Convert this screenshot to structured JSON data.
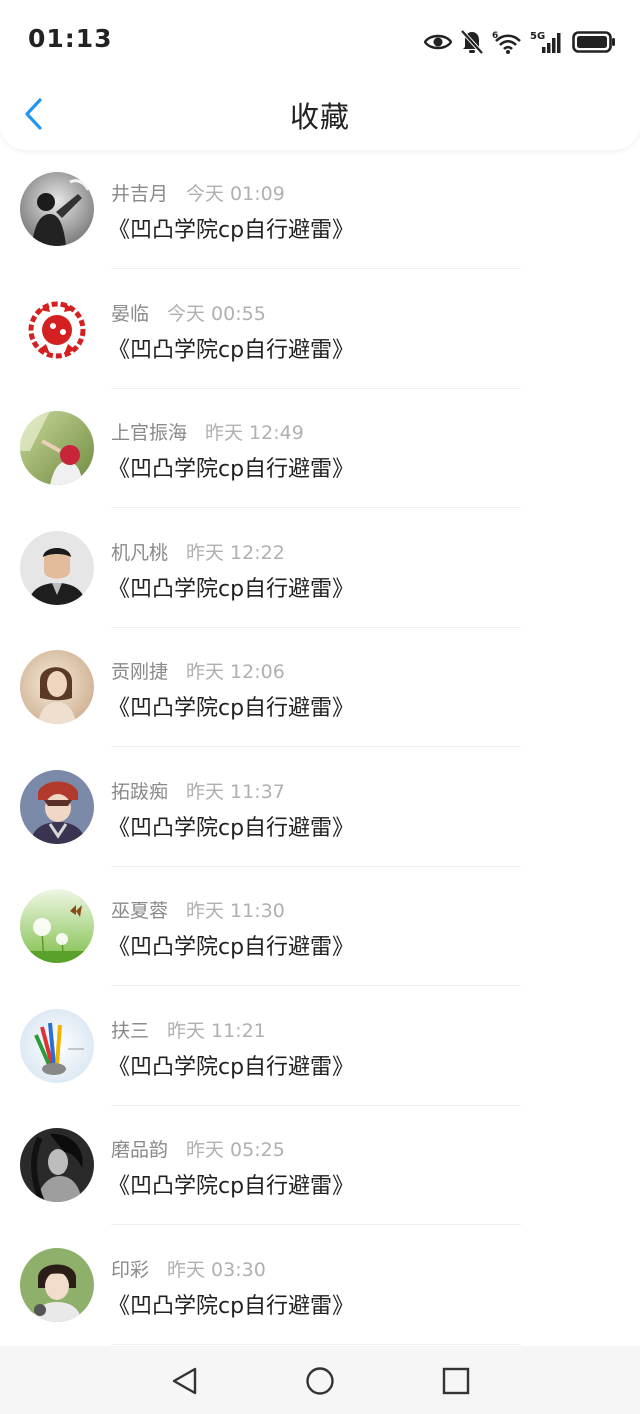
{
  "status_bar": {
    "time": "01:13"
  },
  "header": {
    "title": "收藏"
  },
  "items": [
    {
      "name": "井吉月",
      "time": "今天 01:09",
      "message": "《凹凸学院cp自行避雷》"
    },
    {
      "name": "晏临",
      "time": "今天 00:55",
      "message": "《凹凸学院cp自行避雷》"
    },
    {
      "name": "上官振海",
      "time": "昨天 12:49",
      "message": "《凹凸学院cp自行避雷》"
    },
    {
      "name": "机凡桃",
      "time": "昨天 12:22",
      "message": "《凹凸学院cp自行避雷》"
    },
    {
      "name": "贡刚捷",
      "time": "昨天 12:06",
      "message": "《凹凸学院cp自行避雷》"
    },
    {
      "name": "拓跋痴",
      "time": "昨天 11:37",
      "message": "《凹凸学院cp自行避雷》"
    },
    {
      "name": "巫夏蓉",
      "time": "昨天 11:30",
      "message": "《凹凸学院cp自行避雷》"
    },
    {
      "name": "扶三",
      "time": "昨天 11:21",
      "message": "《凹凸学院cp自行避雷》"
    },
    {
      "name": "磨品韵",
      "time": "昨天 05:25",
      "message": "《凹凸学院cp自行避雷》"
    },
    {
      "name": "印彩",
      "time": "昨天 03:30",
      "message": "《凹凸学院cp自行避雷》"
    }
  ],
  "colors": {
    "accent": "#2196f3",
    "name_text": "#8a8a8a",
    "time_text": "#b0b0b0"
  }
}
